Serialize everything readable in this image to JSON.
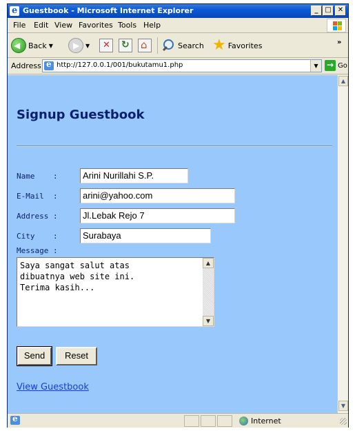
{
  "window": {
    "title": "Guestbook - Microsoft Internet Explorer"
  },
  "menu": {
    "items": [
      "File",
      "Edit",
      "View",
      "Favorites",
      "Tools",
      "Help"
    ]
  },
  "toolbar": {
    "back_label": "Back",
    "search_label": "Search",
    "favorites_label": "Favorites"
  },
  "address": {
    "label": "Address",
    "url": "http://127.0.0.1/001/bukutamu1.php",
    "go_label": "Go"
  },
  "page": {
    "title": "Signup Guestbook",
    "fields": {
      "name": {
        "label": "Name    :",
        "value": "Arini Nurillahi S.P."
      },
      "email": {
        "label": "E-Mail  :",
        "value": "arini@yahoo.com"
      },
      "address": {
        "label": "Address :",
        "value": "Jl.Lebak Rejo 7"
      },
      "city": {
        "label": "City    :",
        "value": "Surabaya"
      },
      "message": {
        "label": "Message :",
        "value": "Saya sangat salut atas\ndibuatnya web site ini.\nTerima kasih..."
      }
    },
    "send_label": "Send",
    "reset_label": "Reset",
    "view_link": "View Guestbook"
  },
  "status": {
    "zone": "Internet"
  },
  "colors": {
    "content_bg": "#98c8fc",
    "title_text": "#0b1f6e",
    "link": "#1a3de0",
    "titlebar": "#0a5bd8"
  }
}
